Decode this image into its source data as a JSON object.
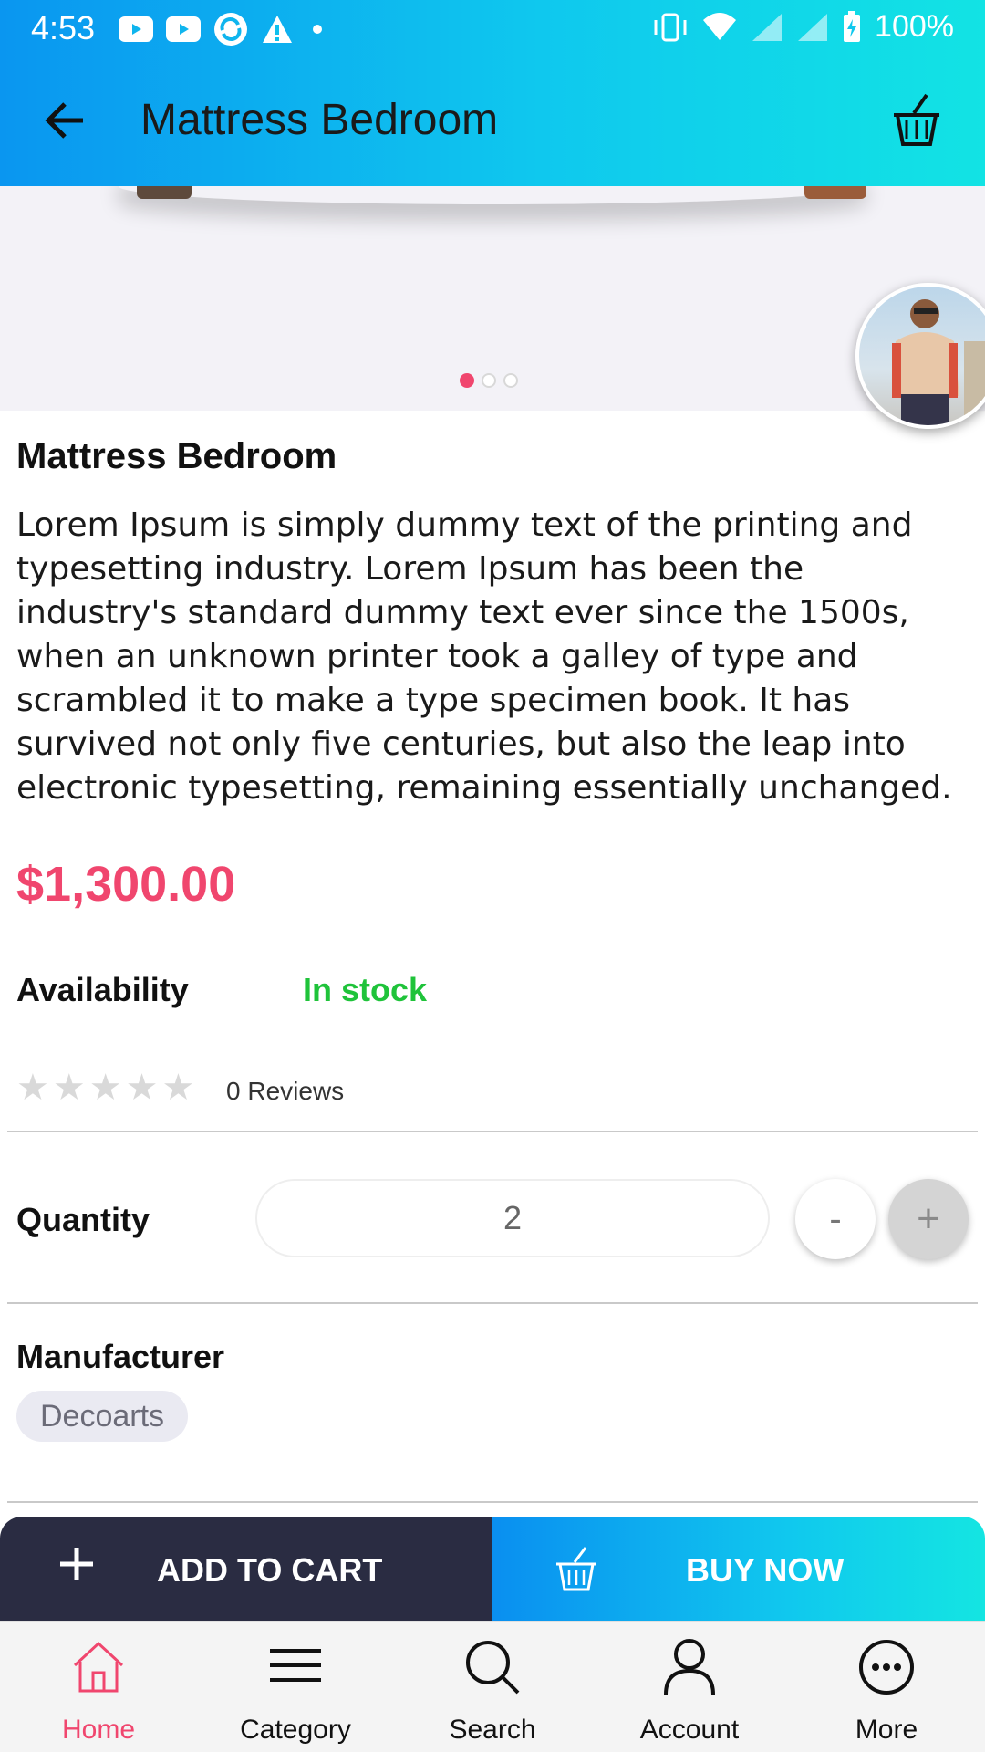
{
  "status_bar": {
    "time": "4:53",
    "battery": "100%"
  },
  "app_bar": {
    "title": "Mattress Bedroom"
  },
  "carousel": {
    "page_count": 3,
    "active_index": 0
  },
  "product": {
    "name": "Mattress Bedroom",
    "description": "Lorem Ipsum is simply dummy text of the printing and typesetting industry. Lorem Ipsum has been the industry's standard dummy text ever since the 1500s, when an unknown printer took a galley of type and scrambled it to make a type specimen book. It has survived not only five centuries, but also the leap into electronic typesetting, remaining essentially unchanged.",
    "price": "$1,300.00",
    "availability_label": "Availability",
    "availability_value": "In stock",
    "rating": 0,
    "reviews": "0 Reviews"
  },
  "quantity": {
    "label": "Quantity",
    "value": "2",
    "minus_label": "-",
    "plus_label": "+"
  },
  "manufacturer": {
    "label": "Manufacturer",
    "value": "Decoarts"
  },
  "actions": {
    "add_to_cart": "ADD TO CART",
    "buy_now": "BUY NOW"
  },
  "bottom_nav": {
    "items": [
      {
        "label": "Home",
        "icon": "home-icon",
        "active": true
      },
      {
        "label": "Category",
        "icon": "menu-icon",
        "active": false
      },
      {
        "label": "Search",
        "icon": "search-icon",
        "active": false
      },
      {
        "label": "Account",
        "icon": "account-icon",
        "active": false
      },
      {
        "label": "More",
        "icon": "more-icon",
        "active": false
      }
    ]
  },
  "colors": {
    "accent": "#f0466e",
    "in_stock": "#1fc33a",
    "header_gradient_start": "#0a96f0",
    "header_gradient_end": "#12e3e4",
    "add_to_cart_bg": "#2a2c42"
  }
}
